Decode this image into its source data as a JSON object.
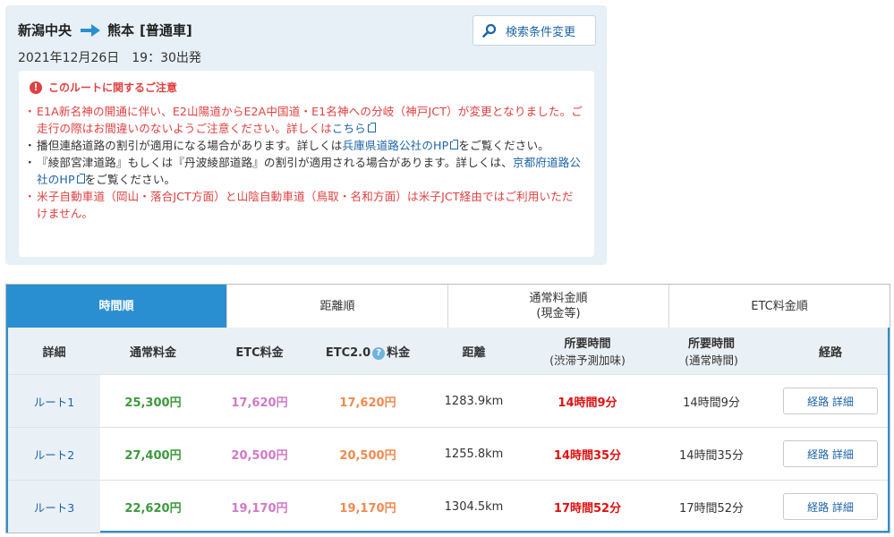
{
  "route": {
    "from": "新潟中央",
    "to": "熊本",
    "vehicle": "[普通車]",
    "departure": "2021年12月26日　19：30出発",
    "search_button": "検索条件変更"
  },
  "notice": {
    "title": "このルートに関するご注意",
    "items": [
      {
        "text": "E1A新名神の開通に伴い、E2山陽道からE2A中国道・E1名神への分岐（神戸JCT）が変更となりました。ご走行の際はお間違いのないようご注意ください。詳しくは",
        "link": "こちら",
        "tail": ""
      },
      {
        "text": "播但連絡道路の割引が適用になる場合があります。詳しくは",
        "link": "兵庫県道路公社のHP",
        "tail": "をご覧ください。"
      },
      {
        "text": "『綾部宮津道路』もしくは『丹波綾部道路』の割引が適用される場合があります。詳しくは、",
        "link": "京都府道路公社のHP",
        "tail": "をご覧ください。"
      },
      {
        "text": "米子自動車道（岡山・落合JCT方面）と山陰自動車道（鳥取・名和方面）は米子JCT経由ではご利用いただけません。",
        "link": "",
        "tail": ""
      }
    ]
  },
  "tabs": [
    {
      "label": "時間順",
      "sub": ""
    },
    {
      "label": "距離順",
      "sub": ""
    },
    {
      "label": "通常料金順",
      "sub": "(現金等)"
    },
    {
      "label": "ETC料金順",
      "sub": ""
    }
  ],
  "headers": {
    "detail": "詳細",
    "normal_fee": "通常料金",
    "etc_fee": "ETC料金",
    "etc2_prefix": "ETC2.0",
    "etc2_suffix": "料金",
    "help_mark": "?",
    "distance": "距離",
    "time_est": "所要時間",
    "time_est_sub": "(渋滞予測加味)",
    "time_normal": "所要時間",
    "time_normal_sub": "(通常時間)",
    "path": "経路"
  },
  "rows": [
    {
      "name": "ルート1",
      "normal": "25,300円",
      "etc": "17,620円",
      "etc2": "17,620円",
      "distance": "1283.9km",
      "time_est": "14時間9分",
      "time_normal": "14時間9分",
      "button": "経路 詳細"
    },
    {
      "name": "ルート2",
      "normal": "27,400円",
      "etc": "20,500円",
      "etc2": "20,500円",
      "distance": "1255.8km",
      "time_est": "14時間35分",
      "time_normal": "14時間35分",
      "button": "経路 詳細"
    },
    {
      "name": "ルート3",
      "normal": "22,620円",
      "etc": "19,170円",
      "etc2": "19,170円",
      "distance": "1304.5km",
      "time_est": "17時間52分",
      "time_normal": "17時間52分",
      "button": "経路 詳細"
    }
  ],
  "colors": {
    "accent": "#2a8fd0",
    "warning": "#e14040",
    "normal_fee": "#3c9a3c",
    "etc_fee": "#d278c8",
    "etc2_fee": "#f08a50",
    "time_est": "#e01010"
  }
}
